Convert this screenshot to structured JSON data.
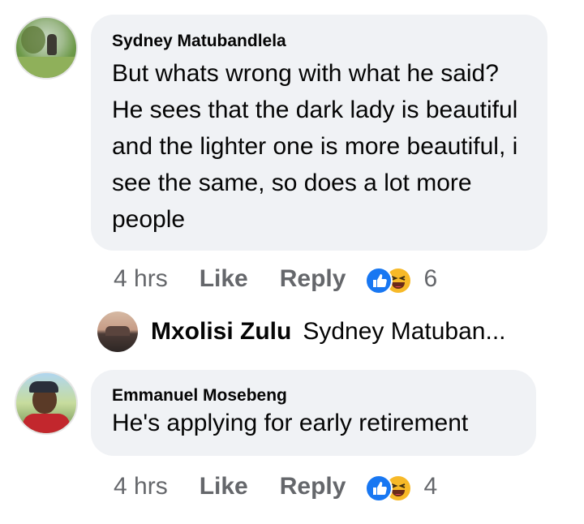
{
  "comments": [
    {
      "author": "Sydney Matubandlela",
      "text": "But whats wrong with what he said? He sees that the dark lady is beautiful and the lighter one is more beautiful, i see the same, so does a lot more people",
      "time": "4 hrs",
      "like_label": "Like",
      "reply_label": "Reply",
      "reaction_count": "6",
      "reactions": [
        "thumbs-up-icon",
        "laughing-face-icon"
      ]
    },
    {
      "author": "Emmanuel Mosebeng",
      "text": "He's applying for early retirement",
      "time": "4 hrs",
      "like_label": "Like",
      "reply_label": "Reply",
      "reaction_count": "4",
      "reactions": [
        "thumbs-up-icon",
        "laughing-face-icon"
      ]
    }
  ],
  "reply_thread": {
    "author": "Mxolisi Zulu",
    "preview": "Sydney Matuban..."
  },
  "colors": {
    "bubble": "#f0f2f5",
    "meta_text": "#65676b",
    "like_blue": "#1877f2",
    "haha_yellow": "#f7b928"
  }
}
